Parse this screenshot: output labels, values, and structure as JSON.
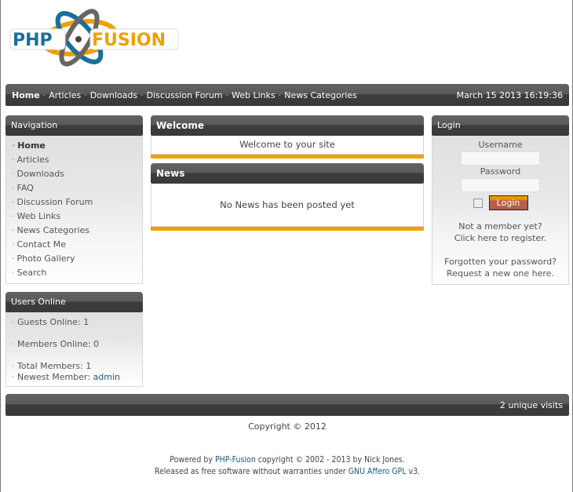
{
  "logo": {
    "text_left": "PHP",
    "text_right": "FUSION",
    "alt": "PHP-Fusion"
  },
  "colors": {
    "accent_orange": "#f2a000",
    "link_blue": "#1a5a82",
    "logo_blue": "#1a6f9a",
    "logo_orange": "#f0a000",
    "login_button": "#b35d4a"
  },
  "topnav": {
    "links": [
      "Home",
      "Articles",
      "Downloads",
      "Discussion Forum",
      "Web Links",
      "News Categories"
    ],
    "separator": "·",
    "datetime": "March 15 2013 16:19:36"
  },
  "navigation": {
    "title": "Navigation",
    "bullet": "·",
    "items": [
      "Home",
      "Articles",
      "Downloads",
      "FAQ",
      "Discussion Forum",
      "Web Links",
      "News Categories",
      "Contact Me",
      "Photo Gallery",
      "Search"
    ]
  },
  "users_online": {
    "title": "Users Online",
    "guests": "Guests Online: 1",
    "members": "Members Online: 0",
    "total": "Total Members: 1",
    "newest_label": "Newest Member: ",
    "newest_name": "admin"
  },
  "welcome": {
    "title": "Welcome",
    "text": "Welcome to your site"
  },
  "news": {
    "title": "News",
    "text": "No News has been posted yet"
  },
  "login": {
    "title": "Login",
    "username_label": "Username",
    "username_value": "",
    "password_label": "Password",
    "password_value": "",
    "remember_checked": false,
    "button": "Login",
    "not_member": "Not a member yet?",
    "register_link": "Click here to register.",
    "forgot": "Forgotten your password?",
    "request_link": "Request a new one here."
  },
  "footer": {
    "visits": "2 unique visits",
    "copyright": "Copyright © 2012",
    "powered_prefix": "Powered by ",
    "powered_link": "PHP-Fusion",
    "powered_suffix": " copyright © 2002 - 2013 by Nick Jones.",
    "released_prefix": "Released as free software without warranties under ",
    "released_link": "GNU Affero GPL",
    "released_suffix": " v3."
  }
}
